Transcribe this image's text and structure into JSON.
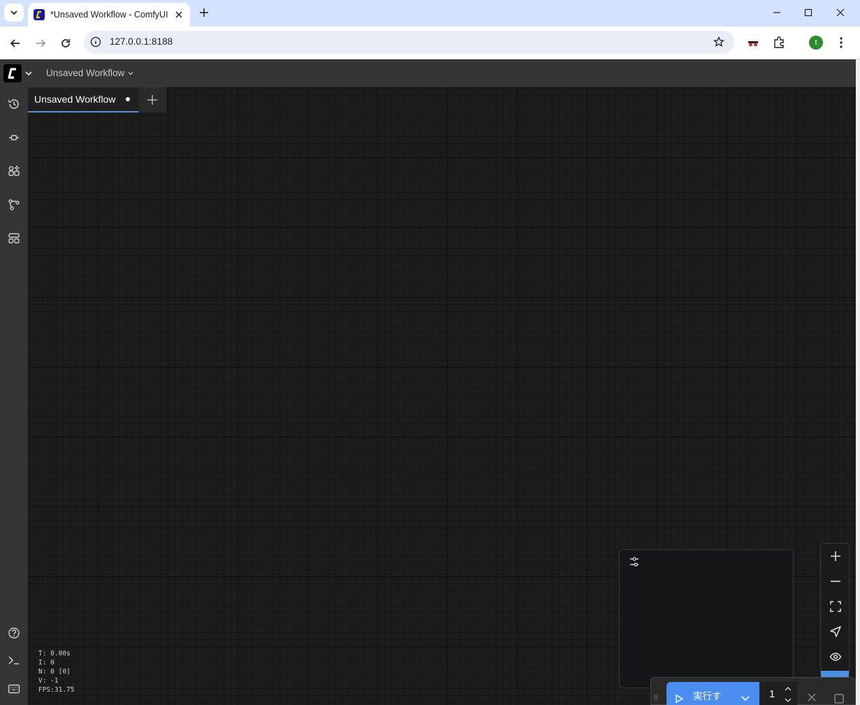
{
  "browser": {
    "tab_title": "*Unsaved Workflow - ComfyUI",
    "url": "127.0.0.1:8188",
    "profile_initial": "t"
  },
  "app": {
    "workflow_menu_label": "Unsaved Workflow",
    "workflow_tab_label": "Unsaved Workflow"
  },
  "stats": {
    "t": "T: 0.00s",
    "i": "I: 0",
    "n": "N: 0 [0]",
    "v": "V: -1",
    "fps": "FPS:31.75"
  },
  "run": {
    "label": "実行す",
    "batch_count": "1"
  },
  "colors": {
    "accent": "#4b8ef0",
    "menubar": "#353535",
    "canvas": "#1c1c1c"
  }
}
